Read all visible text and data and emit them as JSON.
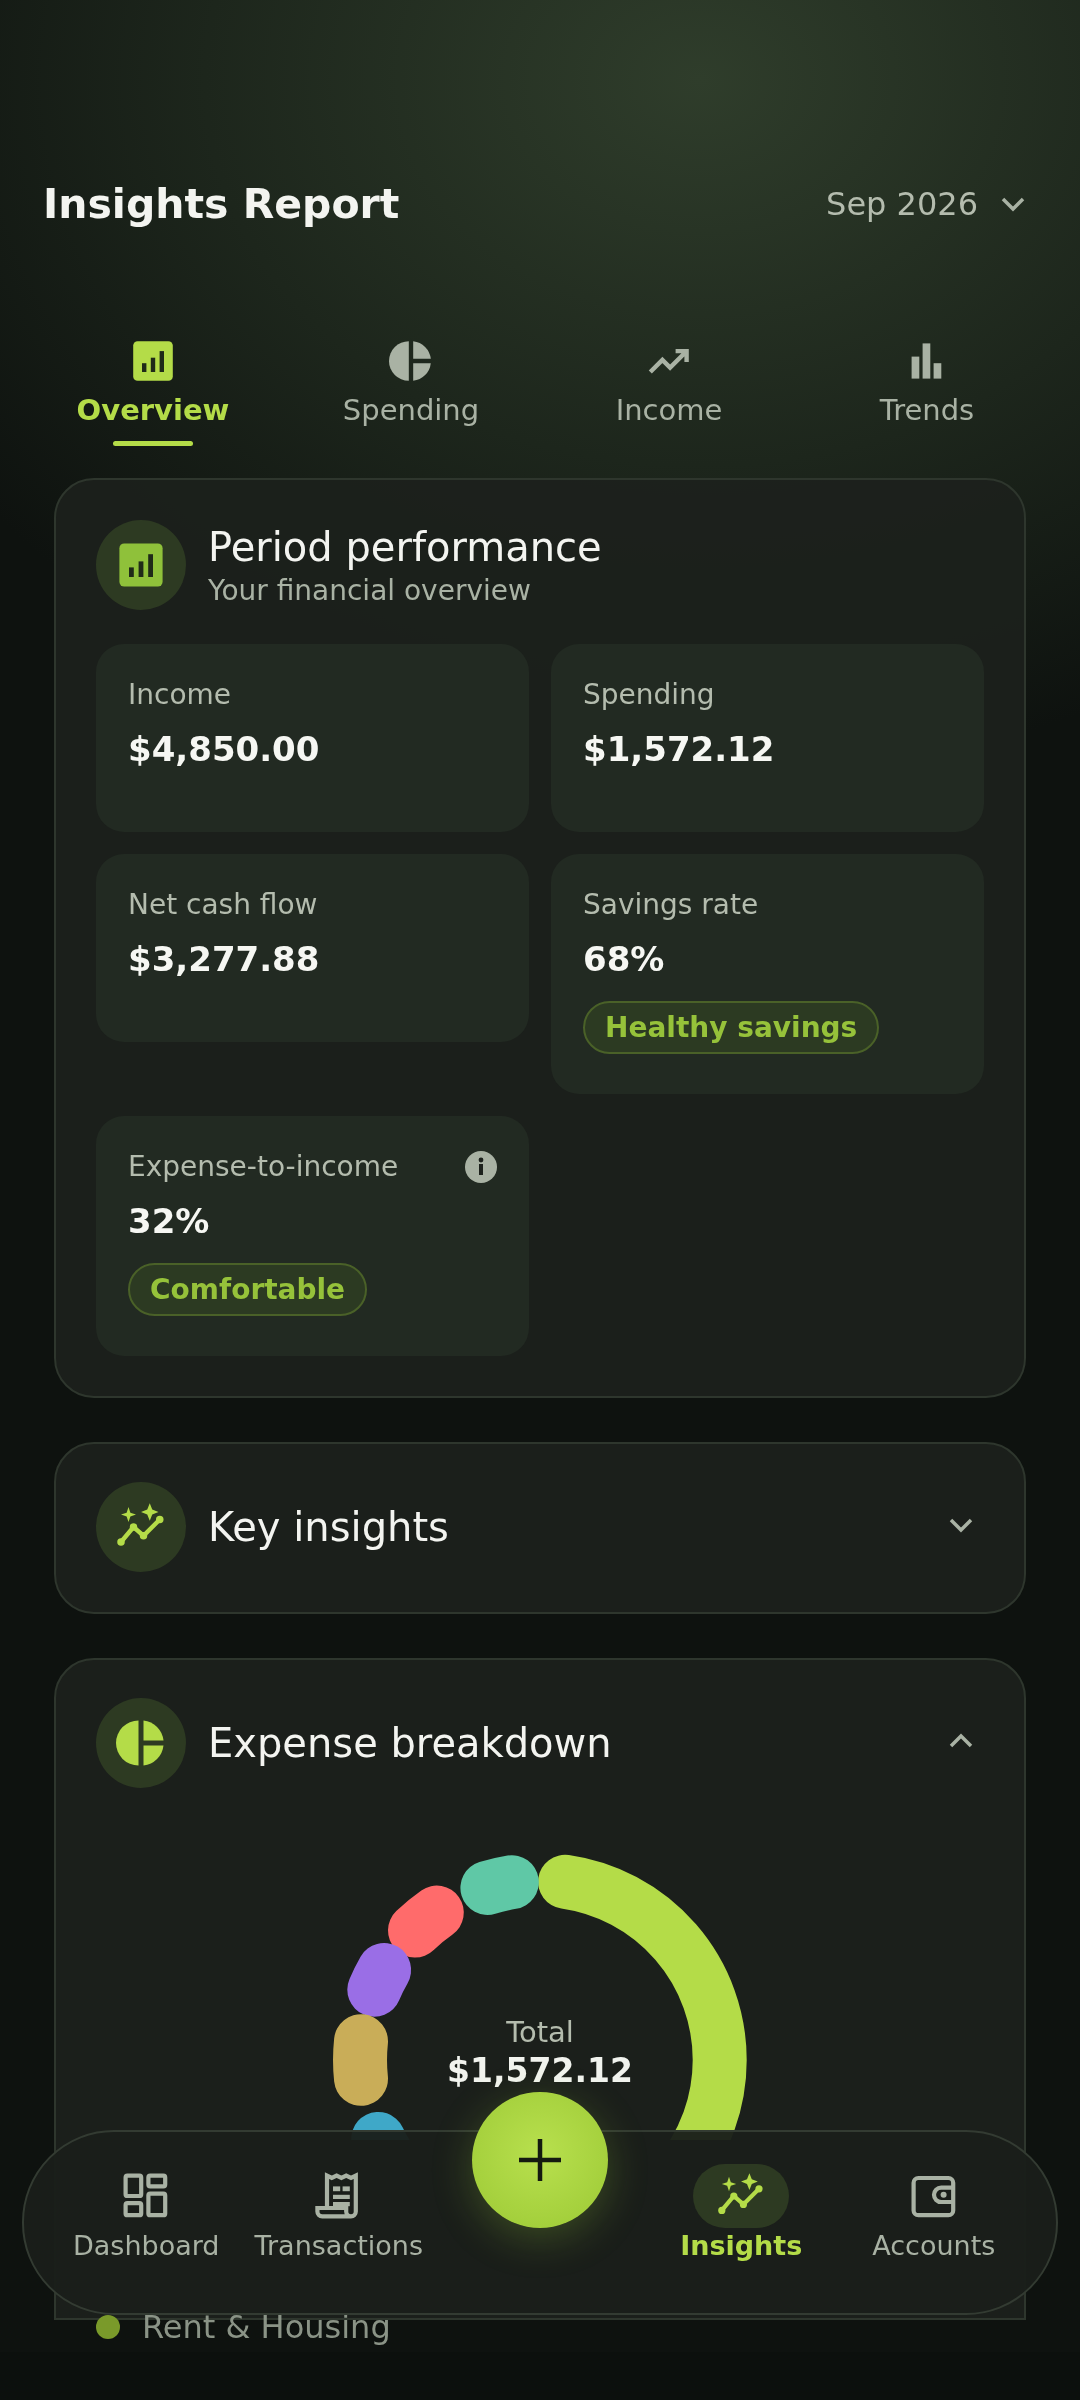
{
  "header": {
    "title": "Insights Report",
    "period": "Sep 2026"
  },
  "tabs": [
    {
      "label": "Overview",
      "kind": "report",
      "selected": true
    },
    {
      "label": "Spending",
      "kind": "pie",
      "selected": false
    },
    {
      "label": "Income",
      "kind": "trend",
      "selected": false
    },
    {
      "label": "Trends",
      "kind": "bars",
      "selected": false
    }
  ],
  "performance": {
    "title": "Period performance",
    "subtitle": "Your financial overview",
    "stats": [
      {
        "label": "Income",
        "value": "$4,850.00"
      },
      {
        "label": "Spending",
        "value": "$1,572.12"
      },
      {
        "label": "Net cash flow",
        "value": "$3,277.88"
      },
      {
        "label": "Savings rate",
        "value": "68%",
        "badge": "Healthy savings"
      },
      {
        "label": "Expense-to-income",
        "value": "32%",
        "badge": "Comfortable",
        "info": true
      }
    ]
  },
  "sections": [
    {
      "title": "Key insights",
      "kind": "sparkle",
      "expanded": false
    },
    {
      "title": "Expense breakdown",
      "kind": "pie",
      "expanded": true,
      "total_label": "Total",
      "total": "$1,572.12",
      "legend": [
        {
          "label": "Rent & Housing",
          "color": "#7a9a2a"
        }
      ]
    }
  ],
  "nav": [
    {
      "label": "Dashboard",
      "kind": "dashboard",
      "selected": false
    },
    {
      "label": "Transactions",
      "kind": "receipt",
      "selected": false
    },
    {
      "label": "Insights",
      "kind": "sparkle",
      "selected": true
    },
    {
      "label": "Accounts",
      "kind": "wallet",
      "selected": false
    }
  ]
}
